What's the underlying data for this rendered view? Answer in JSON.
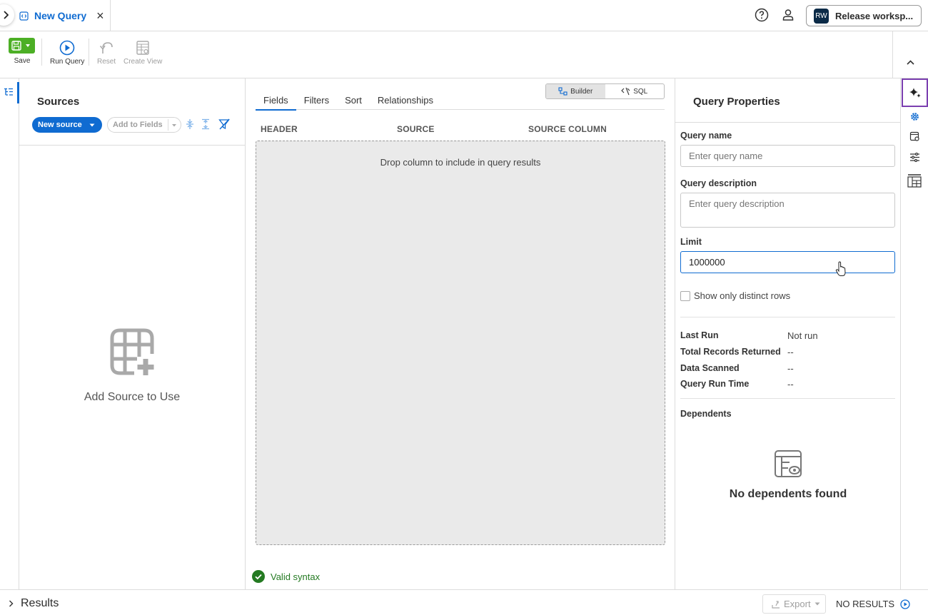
{
  "top_bar": {
    "tab_label": "New Query",
    "tab_close": "×",
    "workspace_initials": "RW",
    "workspace_label": "Release worksp..."
  },
  "toolbar": {
    "save_label": "Save",
    "run_query_label": "Run Query",
    "reset_label": "Reset",
    "create_view_label": "Create View"
  },
  "sources": {
    "title": "Sources",
    "new_source_label": "New source",
    "add_to_fields_label": "Add to Fields",
    "empty_text": "Add Source to Use"
  },
  "center": {
    "mode_builder": "Builder",
    "mode_sql": "SQL",
    "tabs": [
      {
        "label": "Fields",
        "active": true
      },
      {
        "label": "Filters",
        "active": false
      },
      {
        "label": "Sort",
        "active": false
      },
      {
        "label": "Relationships",
        "active": false
      }
    ],
    "columns": [
      "HEADER",
      "SOURCE",
      "SOURCE COLUMN"
    ],
    "drop_text": "Drop column to include in query results",
    "valid_text": "Valid syntax"
  },
  "properties": {
    "title": "Query Properties",
    "query_name_label": "Query name",
    "query_name_placeholder": "Enter query name",
    "query_description_label": "Query description",
    "query_description_placeholder": "Enter query description",
    "limit_label": "Limit",
    "limit_value": "1000000",
    "distinct_label": "Show only distinct rows",
    "stats": [
      {
        "label": "Last Run",
        "value": "Not run"
      },
      {
        "label": "Total Records Returned",
        "value": "--"
      },
      {
        "label": "Data Scanned",
        "value": "--"
      },
      {
        "label": "Query Run Time",
        "value": "--"
      }
    ],
    "dependents_label": "Dependents",
    "no_dependents_text": "No dependents found"
  },
  "bottom_bar": {
    "results_label": "Results",
    "export_label": "Export",
    "no_results_label": "NO RESULTS"
  },
  "colors": {
    "accent": "#0f6bd1",
    "save_green": "#4caf25",
    "valid_green": "#247a22",
    "ai_highlight": "#7b3fb0"
  }
}
